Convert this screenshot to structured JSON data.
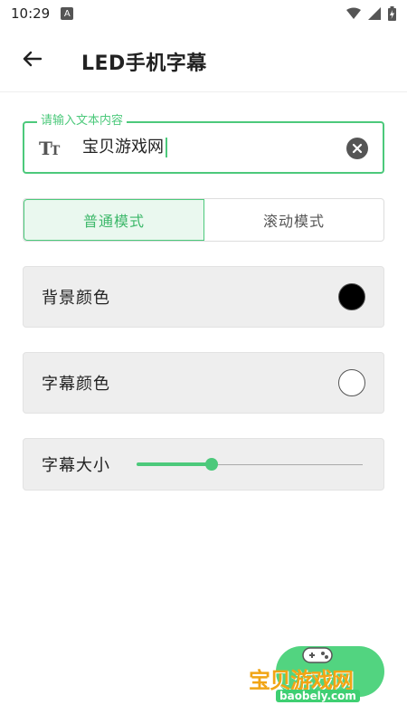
{
  "status_bar": {
    "time": "10:29",
    "notification_glyph": "A"
  },
  "app_bar": {
    "title": "LED手机字幕"
  },
  "text_input": {
    "label": "请输入文本内容",
    "value": "宝贝游戏网",
    "leading_icon": "text-size-icon",
    "trailing_icon": "clear-icon",
    "accent_color": "#4cc97b"
  },
  "mode_toggle": {
    "options": [
      "普通模式",
      "滚动模式"
    ],
    "selected": "普通模式"
  },
  "settings": {
    "background_color": {
      "label": "背景颜色",
      "value": "#000000"
    },
    "text_color": {
      "label": "字幕颜色",
      "value": "#ffffff"
    },
    "text_size": {
      "label": "字幕大小",
      "value_fraction": 0.33
    }
  },
  "watermark": {
    "text": "宝贝游戏网",
    "url": "baobely.com"
  }
}
